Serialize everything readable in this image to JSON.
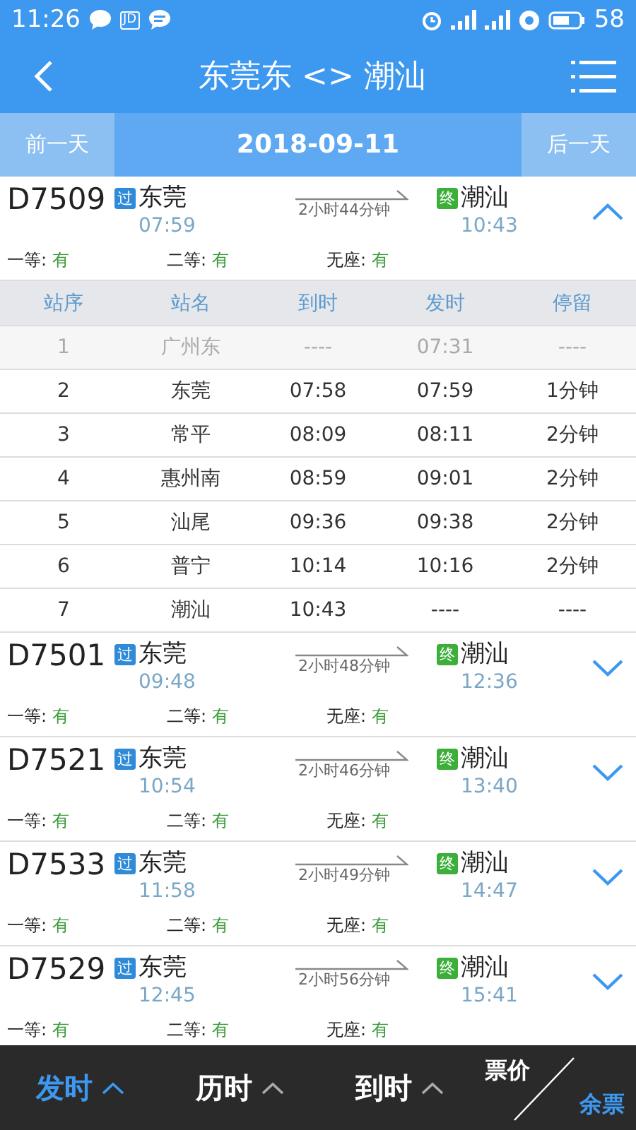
{
  "status_bar": {
    "time": "11:26",
    "notif_badge": "JD",
    "battery": "58"
  },
  "header": {
    "title": "东莞东 <> 潮汕"
  },
  "date_nav": {
    "prev": "前一天",
    "date": "2018-09-11",
    "next": "后一天"
  },
  "trains": [
    {
      "number": "D7509",
      "from_tag": "过",
      "from": "东莞",
      "depart": "07:59",
      "duration": "2小时44分钟",
      "to_tag": "终",
      "to": "潮汕",
      "arrive": "10:43",
      "expanded": true,
      "seats": [
        {
          "label": "一等:",
          "value": "有"
        },
        {
          "label": "二等:",
          "value": "有"
        },
        {
          "label": "无座:",
          "value": "有"
        }
      ],
      "stops": {
        "columns": [
          "站序",
          "站名",
          "到时",
          "发时",
          "停留"
        ],
        "rows": [
          {
            "cells": [
              "1",
              "广州东",
              "----",
              "07:31",
              "----"
            ],
            "passed": true
          },
          {
            "cells": [
              "2",
              "东莞",
              "07:58",
              "07:59",
              "1分钟"
            ],
            "passed": false
          },
          {
            "cells": [
              "3",
              "常平",
              "08:09",
              "08:11",
              "2分钟"
            ],
            "passed": false
          },
          {
            "cells": [
              "4",
              "惠州南",
              "08:59",
              "09:01",
              "2分钟"
            ],
            "passed": false
          },
          {
            "cells": [
              "5",
              "汕尾",
              "09:36",
              "09:38",
              "2分钟"
            ],
            "passed": false
          },
          {
            "cells": [
              "6",
              "普宁",
              "10:14",
              "10:16",
              "2分钟"
            ],
            "passed": false
          },
          {
            "cells": [
              "7",
              "潮汕",
              "10:43",
              "----",
              "----"
            ],
            "passed": false
          }
        ]
      }
    },
    {
      "number": "D7501",
      "from_tag": "过",
      "from": "东莞",
      "depart": "09:48",
      "duration": "2小时48分钟",
      "to_tag": "终",
      "to": "潮汕",
      "arrive": "12:36",
      "expanded": false,
      "seats": [
        {
          "label": "一等:",
          "value": "有"
        },
        {
          "label": "二等:",
          "value": "有"
        },
        {
          "label": "无座:",
          "value": "有"
        }
      ]
    },
    {
      "number": "D7521",
      "from_tag": "过",
      "from": "东莞",
      "depart": "10:54",
      "duration": "2小时46分钟",
      "to_tag": "终",
      "to": "潮汕",
      "arrive": "13:40",
      "expanded": false,
      "seats": [
        {
          "label": "一等:",
          "value": "有"
        },
        {
          "label": "二等:",
          "value": "有"
        },
        {
          "label": "无座:",
          "value": "有"
        }
      ]
    },
    {
      "number": "D7533",
      "from_tag": "过",
      "from": "东莞",
      "depart": "11:58",
      "duration": "2小时49分钟",
      "to_tag": "终",
      "to": "潮汕",
      "arrive": "14:47",
      "expanded": false,
      "seats": [
        {
          "label": "一等:",
          "value": "有"
        },
        {
          "label": "二等:",
          "value": "有"
        },
        {
          "label": "无座:",
          "value": "有"
        }
      ]
    },
    {
      "number": "D7529",
      "from_tag": "过",
      "from": "东莞",
      "depart": "12:45",
      "duration": "2小时56分钟",
      "to_tag": "终",
      "to": "潮汕",
      "arrive": "15:41",
      "expanded": false,
      "seats": [
        {
          "label": "一等:",
          "value": "有"
        },
        {
          "label": "二等:",
          "value": "有"
        },
        {
          "label": "无座:",
          "value": "有"
        }
      ]
    }
  ],
  "sort_bar": [
    {
      "kind": "sort",
      "label": "发时",
      "selected": true
    },
    {
      "kind": "sort",
      "label": "历时",
      "selected": false
    },
    {
      "kind": "sort",
      "label": "到时",
      "selected": false
    },
    {
      "kind": "split",
      "top": "票价",
      "top_selected": false,
      "bottom": "余票",
      "bottom_selected": true
    }
  ]
}
